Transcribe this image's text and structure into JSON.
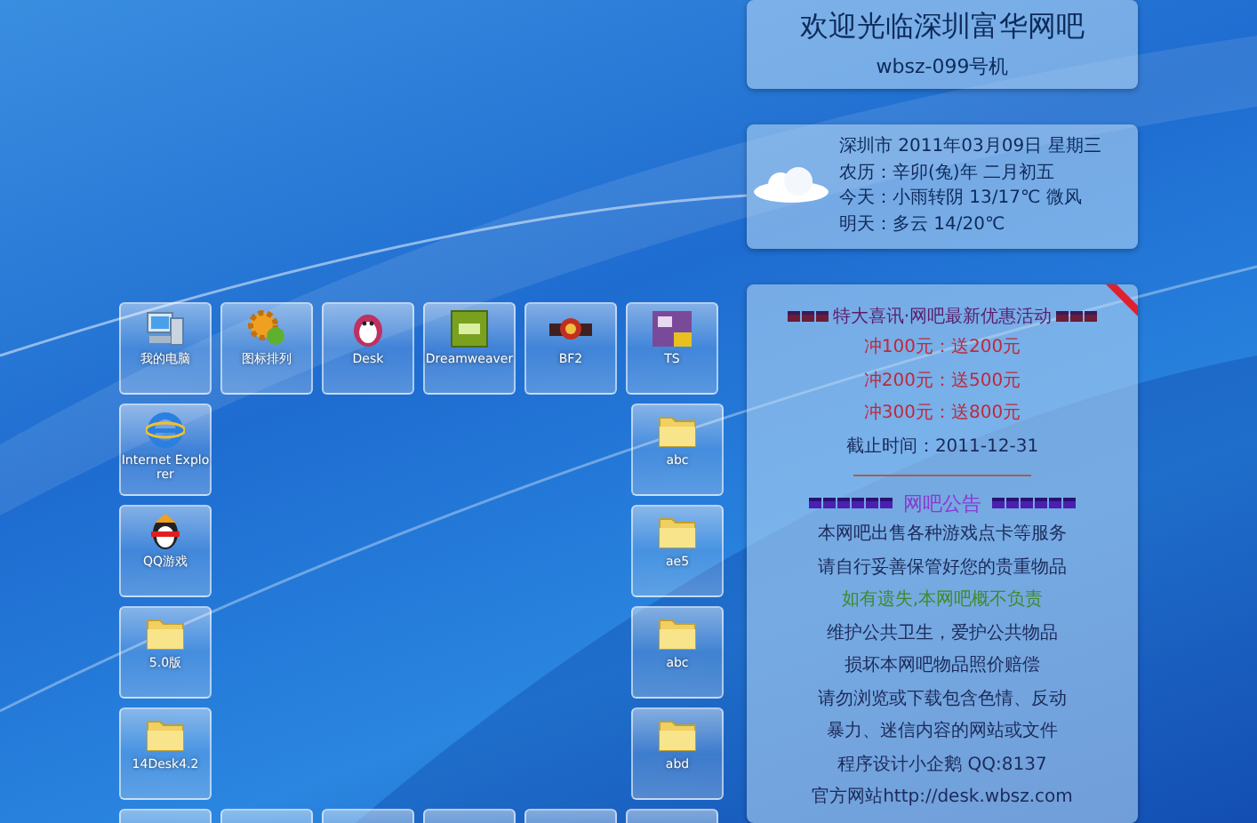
{
  "desktop": {
    "top_row": [
      {
        "label": "我的电脑",
        "kind": "computer"
      },
      {
        "label": "图标排列",
        "kind": "gear"
      },
      {
        "label": "Desk",
        "kind": "penguin"
      },
      {
        "label": "Dreamweaver",
        "kind": "dw"
      },
      {
        "label": "BF2",
        "kind": "game"
      },
      {
        "label": "TS",
        "kind": "ts"
      }
    ],
    "left_column": [
      {
        "label": "Internet Explorer",
        "kind": "ie"
      },
      {
        "label": "QQ游戏",
        "kind": "qq"
      },
      {
        "label": "5.0版",
        "kind": "folder"
      },
      {
        "label": "14Desk4.2",
        "kind": "folder"
      }
    ],
    "right_column": [
      {
        "label": "abc",
        "kind": "folder"
      },
      {
        "label": "ae5",
        "kind": "folder"
      },
      {
        "label": "abc",
        "kind": "folder"
      },
      {
        "label": "abd",
        "kind": "folder"
      }
    ]
  },
  "welcome": {
    "title": "欢迎光临深圳富华网吧",
    "machine": "wbsz-099号机"
  },
  "weather": {
    "lines": [
      "深圳市 2011年03月09日 星期三",
      "农历：辛卯(兔)年 二月初五",
      "今天：小雨转阴 13/17℃ 微风",
      "明天：多云 14/20℃"
    ]
  },
  "promo": {
    "title": "特大喜讯·网吧最新优惠活动",
    "lines": [
      {
        "text": "冲100元：送200元",
        "color": "#c0283a"
      },
      {
        "text": "冲200元：送500元",
        "color": "#c0283a"
      },
      {
        "text": "冲300元：送800元",
        "color": "#c0283a"
      },
      {
        "text": "截止时间：2011-12-31",
        "color": "#1c2a5a"
      }
    ]
  },
  "notice": {
    "title": "网吧公告",
    "lines": [
      {
        "text": "本网吧出售各种游戏点卡等服务",
        "color": "#1c2a5a"
      },
      {
        "text": "请自行妥善保管好您的贵重物品",
        "color": "#1c2a5a"
      },
      {
        "text": "如有遗失,本网吧概不负责",
        "color": "#3f8a2a"
      },
      {
        "text": "维护公共卫生，爱护公共物品",
        "color": "#1c2a5a"
      },
      {
        "text": "损坏本网吧物品照价赔偿",
        "color": "#1c2a5a"
      },
      {
        "text": "请勿浏览或下载包含色情、反动",
        "color": "#1c2a5a"
      },
      {
        "text": "暴力、迷信内容的网站或文件",
        "color": "#1c2a5a"
      },
      {
        "text": "程序设计小企鹅 QQ:8137",
        "color": "#1c2a5a"
      },
      {
        "text": "官方网站http://desk.wbsz.com",
        "color": "#1c2a5a"
      }
    ]
  }
}
